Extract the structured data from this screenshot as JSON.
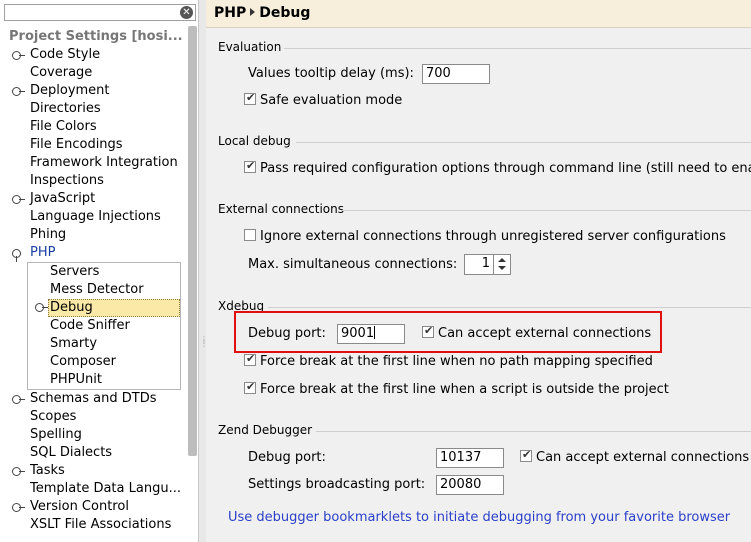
{
  "search": {
    "value": "",
    "clear_icon": "clear-icon"
  },
  "tree": {
    "header": "Project Settings [hosi...",
    "items": [
      {
        "label": "Code Style",
        "toggle": "collapsed"
      },
      {
        "label": "Coverage"
      },
      {
        "label": "Deployment",
        "toggle": "collapsed"
      },
      {
        "label": "Directories"
      },
      {
        "label": "File Colors"
      },
      {
        "label": "File Encodings"
      },
      {
        "label": "Framework Integration"
      },
      {
        "label": "Inspections"
      },
      {
        "label": "JavaScript",
        "toggle": "collapsed"
      },
      {
        "label": "Language Injections"
      },
      {
        "label": "Phing"
      },
      {
        "label": "PHP",
        "toggle": "expanded"
      }
    ],
    "php_children": [
      "Servers",
      "Mess Detector",
      "Debug",
      "Code Sniffer",
      "Smarty",
      "Composer",
      "PHPUnit"
    ],
    "items_after": [
      {
        "label": "Schemas and DTDs",
        "toggle": "collapsed"
      },
      {
        "label": "Scopes"
      },
      {
        "label": "Spelling"
      },
      {
        "label": "SQL Dialects"
      },
      {
        "label": "Tasks",
        "toggle": "collapsed"
      },
      {
        "label": "Template Data Langu..."
      },
      {
        "label": "Version Control",
        "toggle": "collapsed"
      },
      {
        "label": "XSLT File Associations"
      }
    ]
  },
  "breadcrumb": {
    "parent": "PHP",
    "current": "Debug"
  },
  "evaluation": {
    "title": "Evaluation",
    "tooltip_label": "Values tooltip delay (ms):",
    "tooltip_value": "700",
    "safe_label": "Safe evaluation mode",
    "safe_checked": true
  },
  "local_debug": {
    "title": "Local debug",
    "pass_label": "Pass required configuration options through command line (still need to enable",
    "pass_checked": true
  },
  "external": {
    "title": "External connections",
    "ignore_label": "Ignore external connections through unregistered server configurations",
    "ignore_checked": false,
    "max_label": "Max. simultaneous connections:",
    "max_value": "1"
  },
  "xdebug": {
    "title": "Xdebug",
    "port_label": "Debug port:",
    "port_value": "9001",
    "accept_label": "Can accept external connections",
    "accept_checked": true,
    "force1_label": "Force break at the first line when no path mapping specified",
    "force1_checked": true,
    "force2_label": "Force break at the first line when a script is outside the project",
    "force2_checked": true,
    "highlight_color": "#e01010"
  },
  "zend": {
    "title": "Zend Debugger",
    "port_label": "Debug port:",
    "port_value": "10137",
    "accept_label": "Can accept external connections",
    "accept_checked": true,
    "broadcast_label": "Settings broadcasting port:",
    "broadcast_value": "20080"
  },
  "link": "Use debugger bookmarklets to initiate debugging from your favorite browser"
}
